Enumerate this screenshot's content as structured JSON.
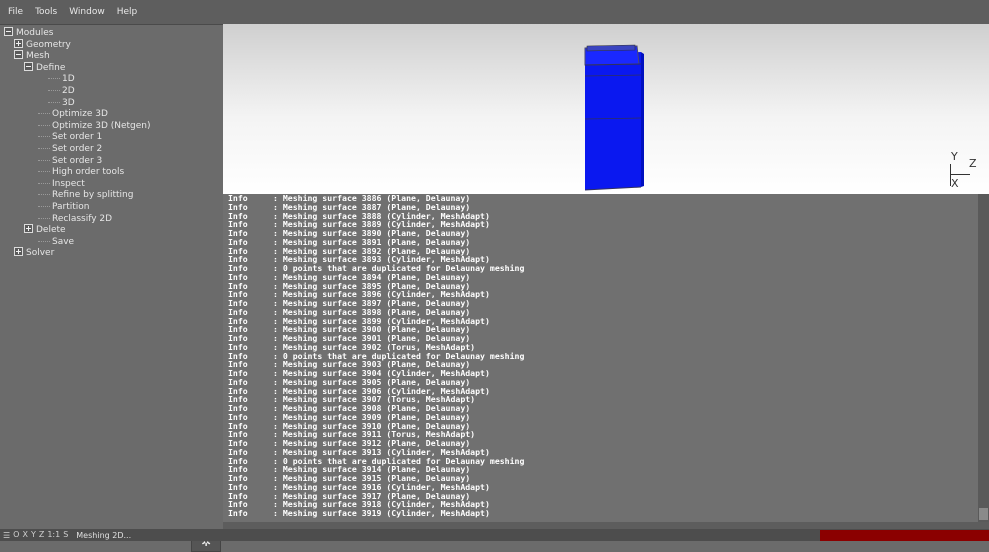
{
  "menubar": {
    "items": [
      "File",
      "Tools",
      "Window",
      "Help"
    ]
  },
  "tree": [
    {
      "label": "Modules",
      "indent": 0,
      "box": "minus"
    },
    {
      "label": "Geometry",
      "indent": 1,
      "box": "plus"
    },
    {
      "label": "Mesh",
      "indent": 1,
      "box": "minus"
    },
    {
      "label": "Define",
      "indent": 2,
      "box": "minus"
    },
    {
      "label": "1D",
      "indent": 3,
      "box": "none"
    },
    {
      "label": "2D",
      "indent": 3,
      "box": "none"
    },
    {
      "label": "3D",
      "indent": 3,
      "box": "none"
    },
    {
      "label": "Optimize 3D",
      "indent": 2,
      "box": "none"
    },
    {
      "label": "Optimize 3D (Netgen)",
      "indent": 2,
      "box": "none"
    },
    {
      "label": "Set order 1",
      "indent": 2,
      "box": "none"
    },
    {
      "label": "Set order 2",
      "indent": 2,
      "box": "none"
    },
    {
      "label": "Set order 3",
      "indent": 2,
      "box": "none"
    },
    {
      "label": "High order tools",
      "indent": 2,
      "box": "none"
    },
    {
      "label": "Inspect",
      "indent": 2,
      "box": "none"
    },
    {
      "label": "Refine by splitting",
      "indent": 2,
      "box": "none"
    },
    {
      "label": "Partition",
      "indent": 2,
      "box": "none"
    },
    {
      "label": "Reclassify 2D",
      "indent": 2,
      "box": "none"
    },
    {
      "label": "Delete",
      "indent": 2,
      "box": "plus"
    },
    {
      "label": "Save",
      "indent": 2,
      "box": "none"
    },
    {
      "label": "Solver",
      "indent": 1,
      "box": "plus"
    }
  ],
  "gear_icon": "✲",
  "viewport": {
    "axis_y": "Y",
    "axis_z": "Z",
    "axis_x": "X",
    "model_color": "#0a18f0"
  },
  "console": [
    [
      "Info",
      ": Meshing surface 3886 (Plane, Delaunay)"
    ],
    [
      "Info",
      ": Meshing surface 3887 (Plane, Delaunay)"
    ],
    [
      "Info",
      ": Meshing surface 3888 (Cylinder, MeshAdapt)"
    ],
    [
      "Info",
      ": Meshing surface 3889 (Cylinder, MeshAdapt)"
    ],
    [
      "Info",
      ": Meshing surface 3890 (Plane, Delaunay)"
    ],
    [
      "Info",
      ": Meshing surface 3891 (Plane, Delaunay)"
    ],
    [
      "Info",
      ": Meshing surface 3892 (Plane, Delaunay)"
    ],
    [
      "Info",
      ": Meshing surface 3893 (Cylinder, MeshAdapt)"
    ],
    [
      "Info",
      ": 0 points that are duplicated for Delaunay meshing"
    ],
    [
      "Info",
      ": Meshing surface 3894 (Plane, Delaunay)"
    ],
    [
      "Info",
      ": Meshing surface 3895 (Plane, Delaunay)"
    ],
    [
      "Info",
      ": Meshing surface 3896 (Cylinder, MeshAdapt)"
    ],
    [
      "Info",
      ": Meshing surface 3897 (Plane, Delaunay)"
    ],
    [
      "Info",
      ": Meshing surface 3898 (Plane, Delaunay)"
    ],
    [
      "Info",
      ": Meshing surface 3899 (Cylinder, MeshAdapt)"
    ],
    [
      "Info",
      ": Meshing surface 3900 (Plane, Delaunay)"
    ],
    [
      "Info",
      ": Meshing surface 3901 (Plane, Delaunay)"
    ],
    [
      "Info",
      ": Meshing surface 3902 (Torus, MeshAdapt)"
    ],
    [
      "Info",
      ": 0 points that are duplicated for Delaunay meshing"
    ],
    [
      "Info",
      ": Meshing surface 3903 (Plane, Delaunay)"
    ],
    [
      "Info",
      ": Meshing surface 3904 (Cylinder, MeshAdapt)"
    ],
    [
      "Info",
      ": Meshing surface 3905 (Plane, Delaunay)"
    ],
    [
      "Info",
      ": Meshing surface 3906 (Cylinder, MeshAdapt)"
    ],
    [
      "Info",
      ": Meshing surface 3907 (Torus, MeshAdapt)"
    ],
    [
      "Info",
      ": Meshing surface 3908 (Plane, Delaunay)"
    ],
    [
      "Info",
      ": Meshing surface 3909 (Plane, Delaunay)"
    ],
    [
      "Info",
      ": Meshing surface 3910 (Plane, Delaunay)"
    ],
    [
      "Info",
      ": Meshing surface 3911 (Torus, MeshAdapt)"
    ],
    [
      "Info",
      ": Meshing surface 3912 (Plane, Delaunay)"
    ],
    [
      "Info",
      ": Meshing surface 3913 (Cylinder, MeshAdapt)"
    ],
    [
      "Info",
      ": 0 points that are duplicated for Delaunay meshing"
    ],
    [
      "Info",
      ": Meshing surface 3914 (Plane, Delaunay)"
    ],
    [
      "Info",
      ": Meshing surface 3915 (Plane, Delaunay)"
    ],
    [
      "Info",
      ": Meshing surface 3916 (Cylinder, MeshAdapt)"
    ],
    [
      "Info",
      ": Meshing surface 3917 (Plane, Delaunay)"
    ],
    [
      "Info",
      ": Meshing surface 3918 (Cylinder, MeshAdapt)"
    ],
    [
      "Info",
      ": Meshing surface 3919 (Cylinder, MeshAdapt)"
    ]
  ],
  "statusbar": {
    "items": [
      "O",
      "X",
      "Y",
      "Z",
      "1:1",
      "S"
    ],
    "message": "Meshing 2D..."
  },
  "progress_color": "#8b0000"
}
